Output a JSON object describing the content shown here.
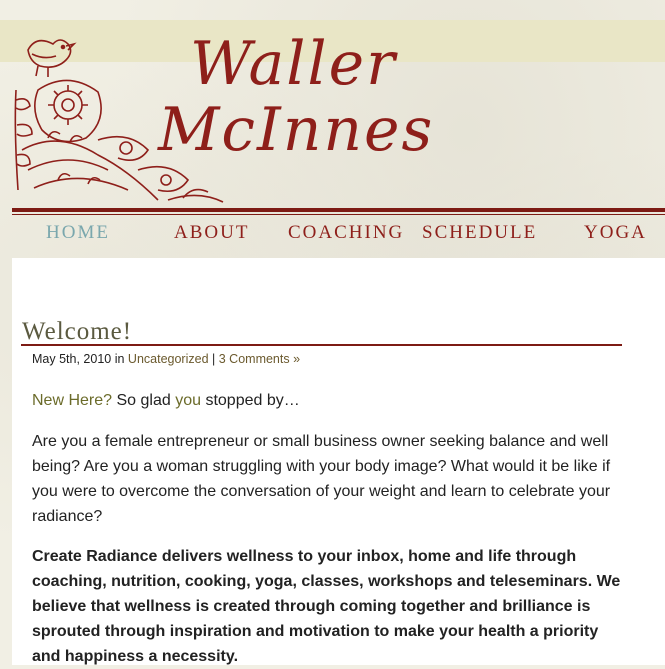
{
  "header": {
    "title_line1": "Waller",
    "title_line2": "McInnes"
  },
  "nav": {
    "items": [
      {
        "label": "HOME",
        "active": true
      },
      {
        "label": "ABOUT",
        "active": false
      },
      {
        "label": "COACHING",
        "active": false
      },
      {
        "label": "SCHEDULE",
        "active": false
      },
      {
        "label": "YOGA",
        "active": false
      }
    ]
  },
  "post": {
    "title": "Welcome!",
    "date": "May 5th, 2010",
    "in_text": "in",
    "category": "Uncategorized",
    "separator": "|",
    "comments": "3 Comments »",
    "intro_link": "New Here?",
    "intro_text1": "So glad",
    "intro_you": "you",
    "intro_text2": "stopped by…",
    "para2": "Are you a female entrepreneur or small business owner seeking balance and well being? Are you a woman struggling with your body image? What would it be like if you were to overcome the conversation of your weight and learn to celebrate your radiance?",
    "para3": "Create Radiance delivers wellness to your inbox, home and life through coaching, nutrition, cooking, yoga, classes, workshops and teleseminars. We believe that wellness is created through coming together and brilliance is sprouted through inspiration and motivation to make your health a priority and happiness a necessity."
  },
  "colors": {
    "brand_red": "#8e1f1a",
    "nav_active": "#7aa7ad",
    "title_olive": "#5b5a40",
    "band": "#e9e6c6"
  }
}
